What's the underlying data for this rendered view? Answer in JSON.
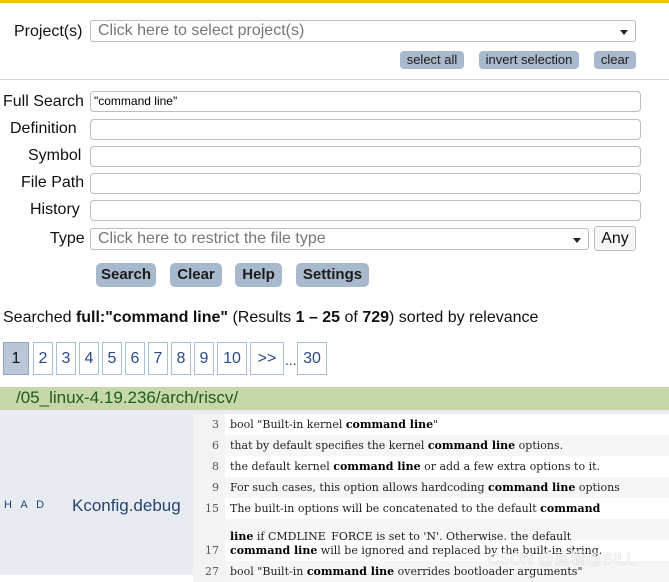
{
  "form": {
    "project_label": "Project(s)",
    "project_placeholder": "Click here to select project(s)",
    "select_all": "select all",
    "invert_selection": "invert selection",
    "clear_small": "clear",
    "full_search_label": "Full Search",
    "full_search_value": "\"command line\"",
    "definition_label": "Definition",
    "definition_value": "",
    "symbol_label": "Symbol",
    "symbol_value": "",
    "file_path_label": "File Path",
    "file_path_value": "",
    "history_label": "History",
    "history_value": "",
    "type_label": "Type",
    "type_placeholder": "Click here to restrict the file type",
    "any_button": "Any"
  },
  "buttons": {
    "search": "Search",
    "clear": "Clear",
    "help": "Help",
    "settings": "Settings"
  },
  "summary": {
    "prefix": "Searched ",
    "query": "full:\"command line\"",
    "results_open": " (Results ",
    "range": "1 – 25",
    "of": " of ",
    "total": "729",
    "suffix": ") sorted by relevance"
  },
  "pager": {
    "pages": [
      "1",
      "2",
      "3",
      "4",
      "5",
      "6",
      "7",
      "8",
      "9",
      "10",
      ">>"
    ],
    "current": "1",
    "ellipsis": "...",
    "last": "30"
  },
  "results": {
    "directory": "/05_linux-4.19.236/arch/riscv/",
    "tag": "H A D",
    "file": "Kconfig.debug",
    "lines": [
      {
        "num": "3",
        "parts": [
          {
            "t": "bool \"Built-in kernel ",
            "b": false
          },
          {
            "t": "command line",
            "b": true
          },
          {
            "t": "\"",
            "b": false
          }
        ]
      },
      {
        "num": "6",
        "parts": [
          {
            "t": "that by default specifies the kernel ",
            "b": false
          },
          {
            "t": "command line",
            "b": true
          },
          {
            "t": " options.",
            "b": false
          }
        ]
      },
      {
        "num": "8",
        "parts": [
          {
            "t": "the default kernel ",
            "b": false
          },
          {
            "t": "command line",
            "b": true
          },
          {
            "t": " or add a few extra options to it.",
            "b": false
          }
        ]
      },
      {
        "num": "9",
        "parts": [
          {
            "t": "For such cases, this option allows hardcoding ",
            "b": false
          },
          {
            "t": "command line",
            "b": true
          },
          {
            "t": " options",
            "b": false
          }
        ]
      },
      {
        "num": "15",
        "parts": [
          {
            "t": "The built-in options will be concatenated to the default ",
            "b": false
          },
          {
            "t": "command",
            "b": true
          }
        ]
      },
      {
        "num": "",
        "parts": [
          {
            "t": "line",
            "b": true
          },
          {
            "t": " if CMDLINE_FORCE is set to 'N'. Otherwise, the default",
            "b": false
          }
        ]
      },
      {
        "num": "17",
        "parts": [
          {
            "t": "command line",
            "b": true
          },
          {
            "t": " will be ignored and replaced by the built-in string.",
            "b": false
          }
        ]
      },
      {
        "num": "27",
        "parts": [
          {
            "t": "bool \"Built-in ",
            "b": false
          },
          {
            "t": "command line",
            "b": true
          },
          {
            "t": " overrides bootloader arguments\"",
            "b": false
          }
        ]
      }
    ]
  },
  "watermark": "CSDN @高桐@BILL"
}
